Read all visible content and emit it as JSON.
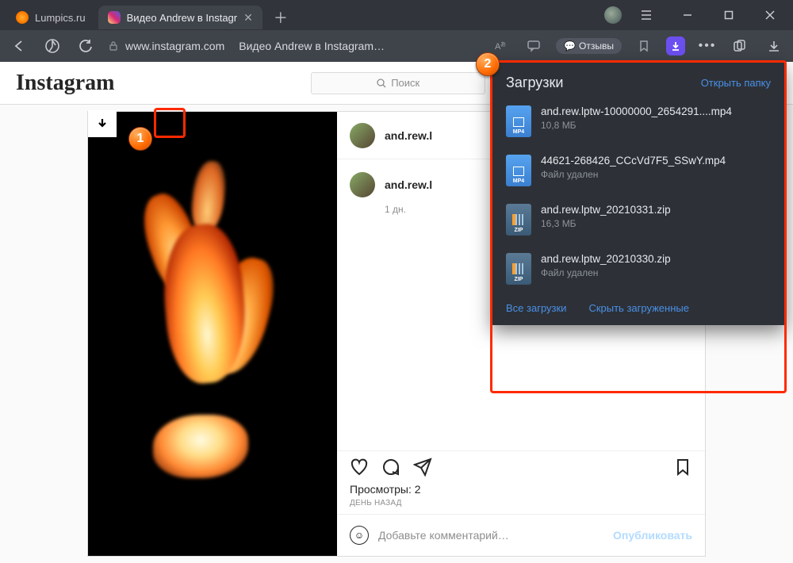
{
  "tabs": {
    "inactive": {
      "title": "Lumpics.ru"
    },
    "active": {
      "title": "Видео Andrew в Instagr"
    }
  },
  "address": {
    "host": "www.instagram.com",
    "page_title": "Видео Andrew в Instagram…",
    "reviews_label": "Отзывы"
  },
  "instagram": {
    "logo": "Instagram",
    "search_placeholder": "Поиск",
    "username": "and.rew.l",
    "comment_username": "and.rew.l",
    "comment_time": "1 дн.",
    "views_label": "Просмотры: 2",
    "timestamp": "ДЕНЬ НАЗАД",
    "comment_placeholder": "Добавьте комментарий…",
    "publish_label": "Опубликовать"
  },
  "downloads": {
    "title": "Загрузки",
    "open_folder": "Открыть папку",
    "items": [
      {
        "name": "and.rew.lptw-10000000_2654291....mp4",
        "sub": "10,8 МБ",
        "type": "mp4"
      },
      {
        "name": "44621-268426_CCcVd7F5_SSwY.mp4",
        "sub": "Файл удален",
        "type": "mp4"
      },
      {
        "name": "and.rew.lptw_20210331.zip",
        "sub": "16,3 МБ",
        "type": "zip"
      },
      {
        "name": "and.rew.lptw_20210330.zip",
        "sub": "Файл удален",
        "type": "zip"
      }
    ],
    "all": "Все загрузки",
    "hide": "Скрыть загруженные"
  },
  "markers": {
    "one": "1",
    "two": "2"
  }
}
